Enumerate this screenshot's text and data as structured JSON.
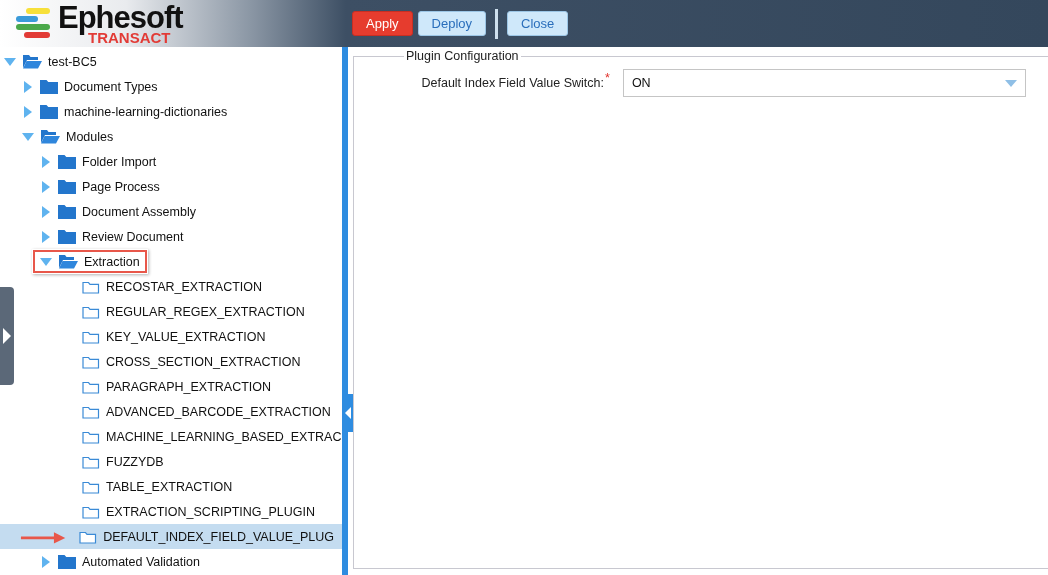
{
  "header": {
    "logo": {
      "name": "Ephesoft",
      "tagline": "TRANSACT"
    },
    "buttons": [
      {
        "label": "Apply",
        "kind": "primary"
      },
      {
        "label": "Deploy",
        "kind": "secondary"
      },
      {
        "label": "Close",
        "kind": "secondary"
      }
    ]
  },
  "tree": [
    {
      "label": "test-BC5",
      "kind": "folder",
      "expanded": true,
      "selected": false,
      "children": [
        {
          "label": "Document Types",
          "kind": "folder",
          "expanded": false,
          "selected": false
        },
        {
          "label": "machine-learning-dictionaries",
          "kind": "folder",
          "expanded": false,
          "selected": false
        },
        {
          "label": "Modules",
          "kind": "folder",
          "expanded": true,
          "selected": false,
          "children": [
            {
              "label": "Folder Import",
              "kind": "folder",
              "expanded": false,
              "selected": false
            },
            {
              "label": "Page Process",
              "kind": "folder",
              "expanded": false,
              "selected": false
            },
            {
              "label": "Document Assembly",
              "kind": "folder",
              "expanded": false,
              "selected": false
            },
            {
              "label": "Review Document",
              "kind": "folder",
              "expanded": false,
              "selected": false
            },
            {
              "label": "Extraction",
              "kind": "folder",
              "expanded": true,
              "selected": false,
              "outlined": true,
              "children": [
                {
                  "label": "RECOSTAR_EXTRACTION",
                  "kind": "plugin",
                  "selected": false
                },
                {
                  "label": "REGULAR_REGEX_EXTRACTION",
                  "kind": "plugin",
                  "selected": false
                },
                {
                  "label": "KEY_VALUE_EXTRACTION",
                  "kind": "plugin",
                  "selected": false
                },
                {
                  "label": "CROSS_SECTION_EXTRACTION",
                  "kind": "plugin",
                  "selected": false
                },
                {
                  "label": "PARAGRAPH_EXTRACTION",
                  "kind": "plugin",
                  "selected": false
                },
                {
                  "label": "ADVANCED_BARCODE_EXTRACTION",
                  "kind": "plugin",
                  "selected": false
                },
                {
                  "label": "MACHINE_LEARNING_BASED_EXTRAC",
                  "kind": "plugin",
                  "selected": false
                },
                {
                  "label": "FUZZYDB",
                  "kind": "plugin",
                  "selected": false
                },
                {
                  "label": "TABLE_EXTRACTION",
                  "kind": "plugin",
                  "selected": false
                },
                {
                  "label": "EXTRACTION_SCRIPTING_PLUGIN",
                  "kind": "plugin",
                  "selected": false
                },
                {
                  "label": "DEFAULT_INDEX_FIELD_VALUE_PLUG",
                  "kind": "plugin",
                  "selected": true,
                  "arrow": true
                }
              ]
            },
            {
              "label": "Automated Validation",
              "kind": "folder",
              "expanded": false,
              "selected": false
            }
          ]
        }
      ]
    }
  ],
  "config": {
    "legend": "Plugin Configuration",
    "fields": [
      {
        "label": "Default Index Field Value Switch:",
        "required_mark": "*",
        "value": "ON"
      }
    ]
  }
}
